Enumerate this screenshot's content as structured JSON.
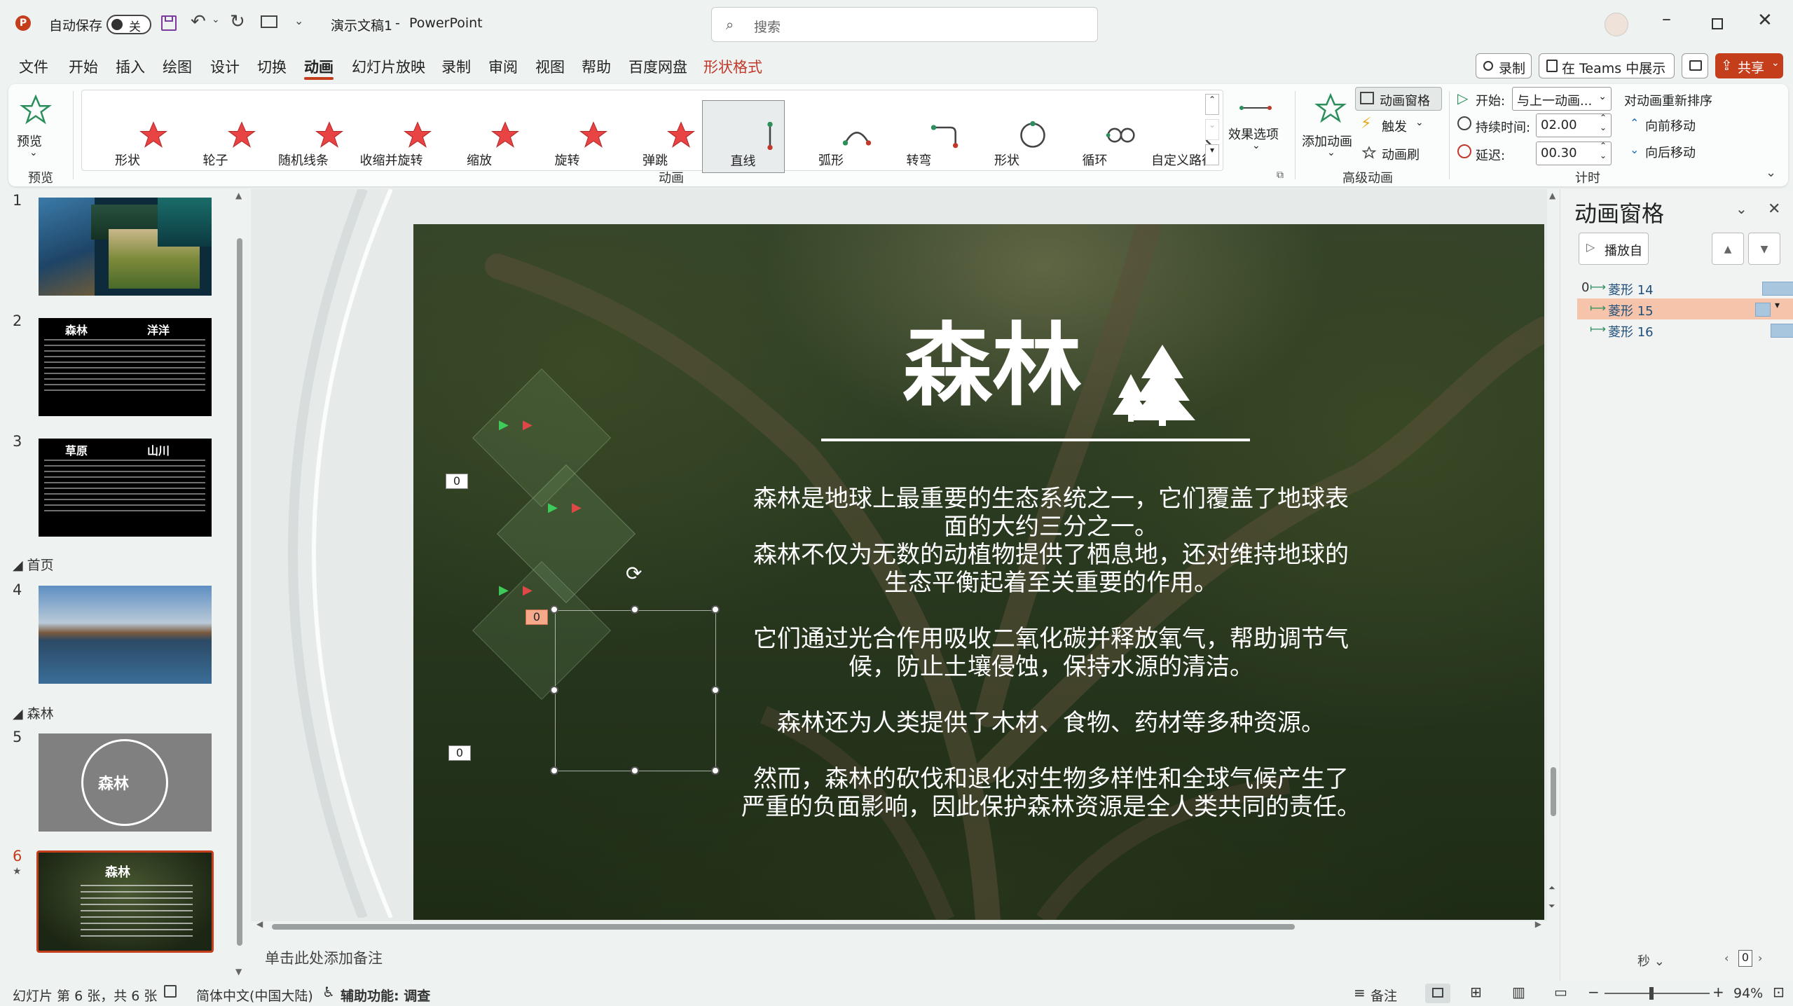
{
  "titlebar": {
    "autosave_label": "自动保存",
    "autosave_state": "关",
    "doc_name": "演示文稿1",
    "app_sep": "-",
    "app_name": "PowerPoint",
    "search_placeholder": "搜索"
  },
  "menu": {
    "tabs": [
      "文件",
      "开始",
      "插入",
      "绘图",
      "设计",
      "切换",
      "动画",
      "幻灯片放映",
      "录制",
      "审阅",
      "视图",
      "帮助",
      "百度网盘",
      "形状格式"
    ],
    "active_tab": "动画",
    "contextual_tab": "形状格式",
    "contextual_color": "#c0392b",
    "record_button": "录制",
    "teams_button": "在 Teams 中展示",
    "share_button": "共享",
    "share_color": "#c43e1c"
  },
  "ribbon": {
    "preview_label": "预览",
    "preview_group": "预览",
    "gallery": [
      {
        "label": "形状",
        "icon": "star-red-icon"
      },
      {
        "label": "轮子",
        "icon": "star-red-icon"
      },
      {
        "label": "随机线条",
        "icon": "star-red-icon"
      },
      {
        "label": "收缩并旋转",
        "icon": "star-red-icon"
      },
      {
        "label": "缩放",
        "icon": "star-red-icon"
      },
      {
        "label": "旋转",
        "icon": "star-red-icon"
      },
      {
        "label": "弹跳",
        "icon": "star-red-icon"
      },
      {
        "label": "直线",
        "icon": "line-path-icon"
      },
      {
        "label": "弧形",
        "icon": "arc-path-icon"
      },
      {
        "label": "转弯",
        "icon": "turn-path-icon"
      },
      {
        "label": "形状",
        "icon": "circle-path-icon"
      },
      {
        "label": "循环",
        "icon": "loop-path-icon"
      },
      {
        "label": "自定义路径",
        "icon": "custom-path-icon"
      }
    ],
    "selected_gallery_index": 7,
    "effect_options": "效果选项",
    "animation_group": "动画",
    "add_animation": "添加动画",
    "animation_pane_btn": "动画窗格",
    "trigger_btn": "触发",
    "painter_btn": "动画刷",
    "advanced_group": "高级动画",
    "start_label": "开始:",
    "start_value": "与上一动画...",
    "duration_label": "持续时间:",
    "duration_value": "02.00",
    "delay_label": "延迟:",
    "delay_value": "00.30",
    "reorder_label": "对动画重新排序",
    "move_earlier": "向前移动",
    "move_later": "向后移动",
    "timing_group": "计时"
  },
  "slides_panel": {
    "items": [
      {
        "num": "1"
      },
      {
        "num": "2",
        "title_left": "森林",
        "title_right": "洋洋"
      },
      {
        "num": "3",
        "title_left": "草原",
        "title_right": "山川"
      },
      {
        "num": "4"
      },
      {
        "num": "5",
        "circle_text": "森林"
      },
      {
        "num": "6",
        "title": "森林"
      }
    ],
    "section_home": "首页",
    "section_forest": "森林",
    "current_slide": "6"
  },
  "slide": {
    "title": "森林",
    "paragraphs": [
      "森林是地球上最重要的生态系统之一，它们覆盖了地球表",
      "面的大约三分之一。",
      "森林不仅为无数的动植物提供了栖息地，还对维持地球的",
      "生态平衡起着至关重要的作用。",
      "它们通过光合作用吸收二氧化碳并释放氧气，帮助调节气",
      "候，防止土壤侵蚀，保持水源的清洁。",
      "森林还为人类提供了木材、食物、药材等多种资源。",
      "然而，森林的砍伐和退化对生物多样性和全球气候产生了",
      "严重的负面影响，因此保护森林资源是全人类共同的责任。"
    ],
    "anim_tags": [
      "0",
      "0",
      "0"
    ]
  },
  "notes_placeholder": "单击此处添加备注",
  "anim_pane": {
    "title": "动画窗格",
    "play_from": "播放自",
    "items": [
      {
        "index": "0",
        "name": "菱形 14",
        "selected": false
      },
      {
        "index": "",
        "name": "菱形 15",
        "selected": true
      },
      {
        "index": "",
        "name": "菱形 16",
        "selected": false
      }
    ],
    "seconds_label": "秒",
    "page_value": "0"
  },
  "status": {
    "slide_info": "幻灯片 第 6 张，共 6 张",
    "language": "简体中文(中国大陆)",
    "accessibility": "辅助功能: 调查",
    "notes_btn": "备注",
    "zoom": "94%"
  }
}
